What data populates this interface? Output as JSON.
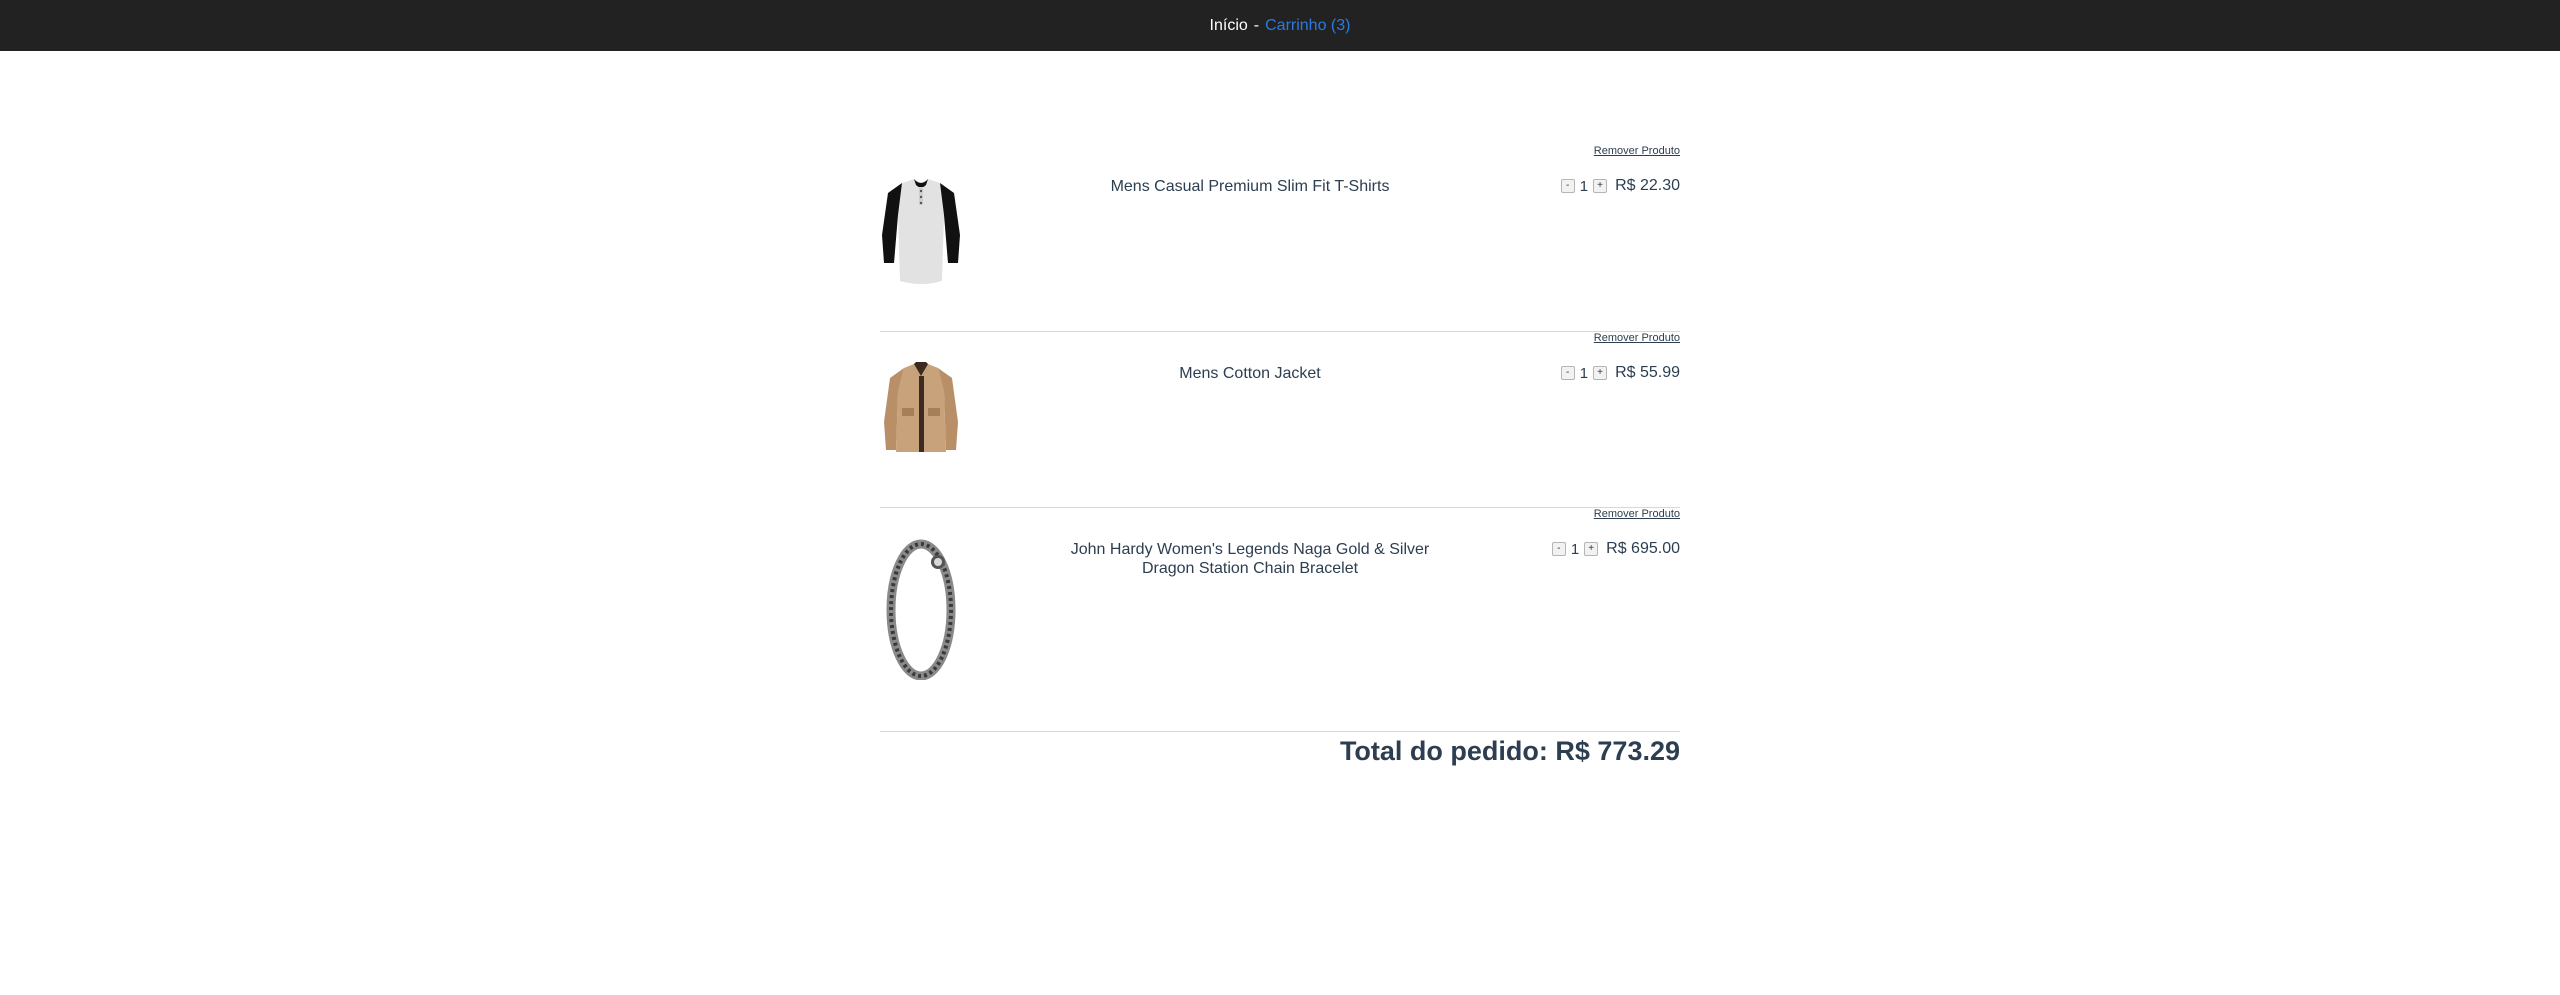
{
  "nav": {
    "home_label": "Início",
    "separator": "-",
    "cart_label": "Carrinho (3)"
  },
  "cart": {
    "remove_label": "Remover Produto",
    "items": [
      {
        "name": "Mens Casual Premium Slim Fit T-Shirts",
        "quantity": "1",
        "price": "R$ 22.30",
        "minus": "-",
        "plus": "+",
        "icon": "tshirt-image"
      },
      {
        "name": "Mens Cotton Jacket",
        "quantity": "1",
        "price": "R$ 55.99",
        "minus": "-",
        "plus": "+",
        "icon": "jacket-image"
      },
      {
        "name": "John Hardy Women's Legends Naga Gold & Silver Dragon Station Chain Bracelet",
        "quantity": "1",
        "price": "R$ 695.00",
        "minus": "-",
        "plus": "+",
        "icon": "bracelet-image"
      }
    ],
    "total_text": "Total do pedido: R$ 773.29"
  }
}
